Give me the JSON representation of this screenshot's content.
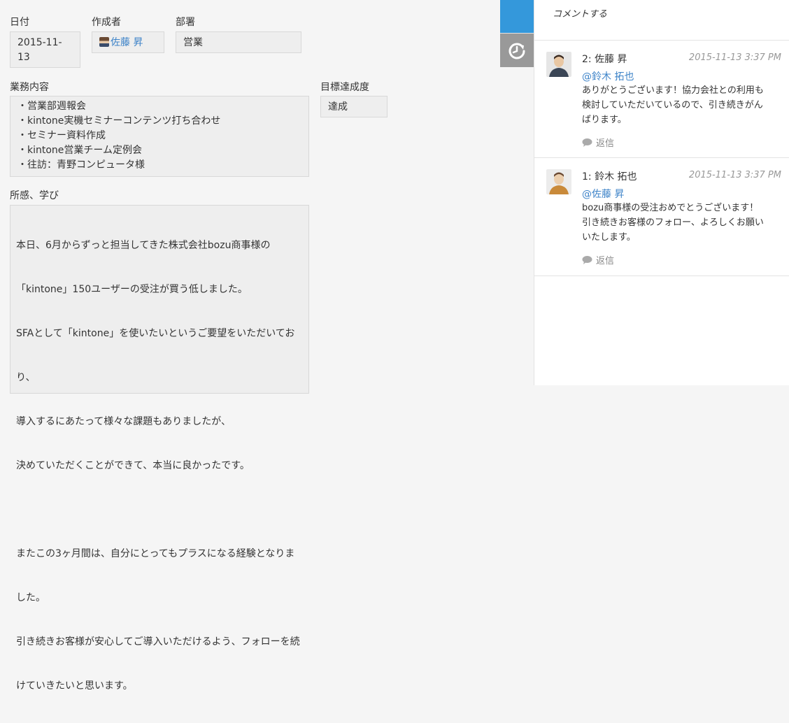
{
  "record": {
    "date": {
      "label": "日付",
      "value_line1": "2015-11-",
      "value_line2": "13"
    },
    "creator": {
      "label": "作成者",
      "value": "佐藤 昇"
    },
    "department": {
      "label": "部署",
      "value": "営業"
    },
    "work": {
      "label": "業務内容",
      "lines": [
        "・営業部週報会",
        "・kintone実機セミナーコンテンツ打ち合わせ",
        "・セミナー資料作成",
        "・kintone営業チーム定例会",
        "・往訪：青野コンピュータ様"
      ]
    },
    "goal": {
      "label": "目標達成度",
      "value": "達成"
    },
    "impressions": {
      "label": "所感、学び",
      "lines": [
        "本日、6月からずっと担当してきた株式会社bozu商事様の",
        "「kintone」150ユーザーの受注が買う低しました。",
        "SFAとして「kintone」を使いたいというご要望をいただいてお",
        "り、",
        "導入するにあたって様々な課題もありましたが、",
        "決めていただくことができて、本当に良かったです。",
        "",
        "またこの3ヶ月間は、自分にとってもプラスになる経験となりま",
        "した。",
        "引き続きお客様が安心してご導入いただけるよう、フォローを続",
        "けていきたいと思います。"
      ]
    }
  },
  "tabs": {
    "comment_icon": "speech-bubble-icon",
    "history_icon": "history-icon"
  },
  "comments": {
    "input_placeholder": "コメントする",
    "items": [
      {
        "name": "2: 佐藤 昇",
        "date": "2015-11-13 3:37 PM",
        "mention": "@鈴木 拓也",
        "lines": [
          "ありがとうございます！協力会社との利用も",
          "検討していただいているので、引き続きがん",
          "ばります。"
        ],
        "reply": "返信"
      },
      {
        "name": "1: 鈴木 拓也",
        "date": "2015-11-13 3:37 PM",
        "mention": "@佐藤 昇",
        "lines": [
          "bozu商事様の受注おめでとうございます！",
          "引き続きお客様のフォロー、よろしくお願い",
          "いたします。"
        ],
        "reply": "返信"
      }
    ]
  },
  "colors": {
    "accent": "#3498db",
    "link": "#3d83c8",
    "tab_inactive": "#999999"
  }
}
